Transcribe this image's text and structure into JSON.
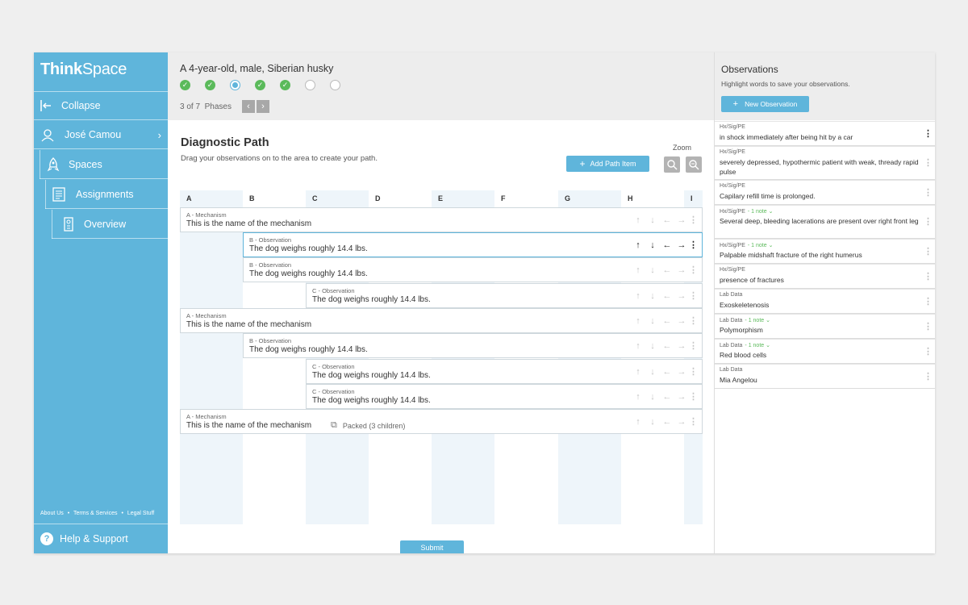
{
  "sidebar": {
    "brand_bold": "Think",
    "brand_rest": "Space",
    "collapse_label": "Collapse",
    "user_name": "José Camou",
    "spaces_label": "Spaces",
    "assignments_label": "Assignments",
    "overview_label": "Overview",
    "footer": {
      "about": "About Us",
      "terms": "Terms & Services",
      "legal": "Legal Stuff",
      "sep": "•"
    },
    "help_label": "Help & Support"
  },
  "header": {
    "case_title": "A 4-year-old, male, Siberian husky",
    "phases": [
      "done",
      "done",
      "current",
      "done",
      "done",
      "todo",
      "todo"
    ],
    "phase_of": "3 of",
    "phase_total": "7",
    "phase_word": "Phases"
  },
  "diagnostic": {
    "title": "Diagnostic Path",
    "subtitle": "Drag your observations on to the area to create your path.",
    "add_label": "Add Path Item",
    "zoom_label": "Zoom",
    "columns": [
      "A",
      "B",
      "C",
      "D",
      "E",
      "F",
      "G",
      "H",
      "I"
    ],
    "rows": [
      {
        "label": "A - Mechanism",
        "text": "This is the name of the mechanism"
      },
      {
        "label": "B - Observation",
        "text": "The dog weighs roughly 14.4 lbs."
      },
      {
        "label": "B - Observation",
        "text": "The dog weighs roughly 14.4 lbs."
      },
      {
        "label": "C - Observation",
        "text": "The dog weighs roughly 14.4 lbs."
      },
      {
        "label": "A - Mechanism",
        "text": "This is the name of the mechanism"
      },
      {
        "label": "B - Observation",
        "text": "The dog weighs roughly 14.4 lbs."
      },
      {
        "label": "C - Observation",
        "text": "The dog weighs roughly 14.4 lbs."
      },
      {
        "label": "C - Observation",
        "text": "The dog weighs roughly 14.4 lbs."
      },
      {
        "label": "A - Mechanism",
        "text": "This is the name of the mechanism",
        "packed": "Packed (3 children)"
      }
    ],
    "submit_label": "Submit"
  },
  "observations": {
    "title": "Observations",
    "subtitle": "Highlight words to save your observations.",
    "new_label": "New Observation",
    "items": [
      {
        "cat": "Hx/Sig/PE",
        "note": "",
        "text": "in shock immediately after being hit by a car"
      },
      {
        "cat": "Hx/Sig/PE",
        "note": "",
        "text": "severely depressed, hypothermic patient with weak, thready rapid pulse"
      },
      {
        "cat": "Hx/Sig/PE",
        "note": "",
        "text": "Capilary refill time is prolonged."
      },
      {
        "cat": "Hx/Sig/PE",
        "note": "- 1 note ⌄",
        "text": "Several deep, bleeding lacerations are present over right front leg"
      },
      {
        "cat": "Hx/Sig/PE",
        "note": "- 1 note ⌄",
        "text": "Palpable midshaft fracture of the right humerus"
      },
      {
        "cat": "Hx/Sig/PE",
        "note": "",
        "text": "presence of fractures"
      },
      {
        "cat": "Lab Data",
        "note": "",
        "text": "Exoskeletenosis"
      },
      {
        "cat": "Lab Data",
        "note": "- 1 note ⌄",
        "text": "Polymorphism"
      },
      {
        "cat": "Lab Data",
        "note": "- 1 note ⌄",
        "text": "Red blood cells"
      },
      {
        "cat": "Lab Data",
        "note": "",
        "text": "Mia Angelou"
      }
    ]
  },
  "icons": {
    "check": "✓",
    "prev": "‹",
    "next": "›",
    "up": "↑",
    "down": "↓",
    "left": "←",
    "right": "→",
    "kebab": "⋮",
    "plus": "+",
    "chevron": "›"
  },
  "colors": {
    "accent": "#5fb5db",
    "success": "#5bba5b",
    "header_bg": "#ededed",
    "column_shade": "#eef5fa"
  }
}
